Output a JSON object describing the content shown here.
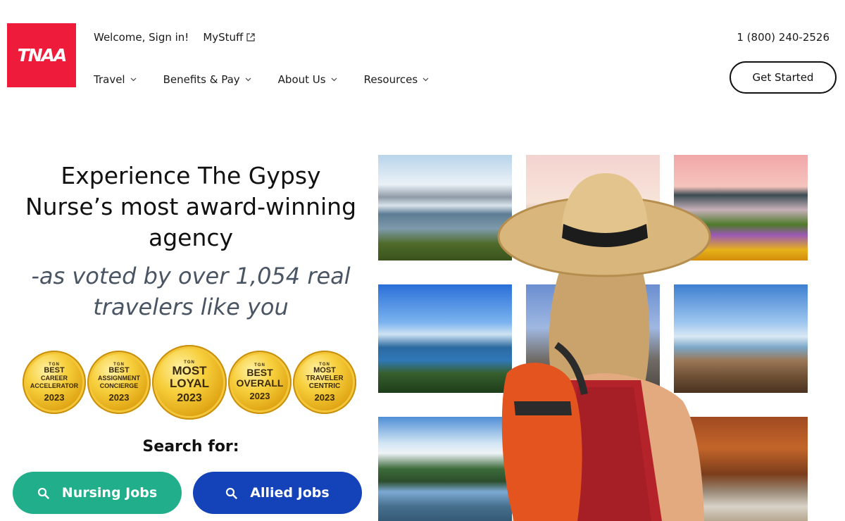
{
  "brand": {
    "logo_text": "TNAA",
    "accent": "#ee1b3b"
  },
  "header": {
    "sign_in": "Welcome, Sign in!",
    "mystuff": "MyStuff",
    "phone": "1 (800) 240-2526",
    "cta": "Get Started",
    "nav": [
      {
        "label": "Travel"
      },
      {
        "label": "Benefits & Pay"
      },
      {
        "label": "About Us"
      },
      {
        "label": "Resources"
      }
    ]
  },
  "hero": {
    "headline": "Experience The Gypsy Nurse’s most award-winning agency",
    "subline": "-as voted by over 1,054 real travelers like you",
    "search_label": "Search for:",
    "buttons": {
      "nursing": "Nursing Jobs",
      "allied": "Allied Jobs"
    },
    "colors": {
      "nursing": "#21ae8a",
      "allied": "#1442b8"
    }
  },
  "badges": [
    {
      "top": "TGN",
      "line1": "BEST",
      "line2": "CAREER ACCELERATOR",
      "year": "2023"
    },
    {
      "top": "TGN",
      "line1": "BEST",
      "line2": "ASSIGNMENT CONCIERGE",
      "year": "2023"
    },
    {
      "top": "TGN",
      "line1": "MOST",
      "line2": "LOYAL",
      "year": "2023"
    },
    {
      "top": "TGN",
      "line1": "BEST",
      "line2": "OVERALL",
      "year": "2023"
    },
    {
      "top": "TGN",
      "line1": "MOST",
      "line2": "TRAVELER CENTRIC",
      "year": "2023"
    }
  ],
  "icons": {
    "mystuff": "external-link-icon",
    "nav": "chevron-down-icon",
    "search": "search-icon"
  }
}
